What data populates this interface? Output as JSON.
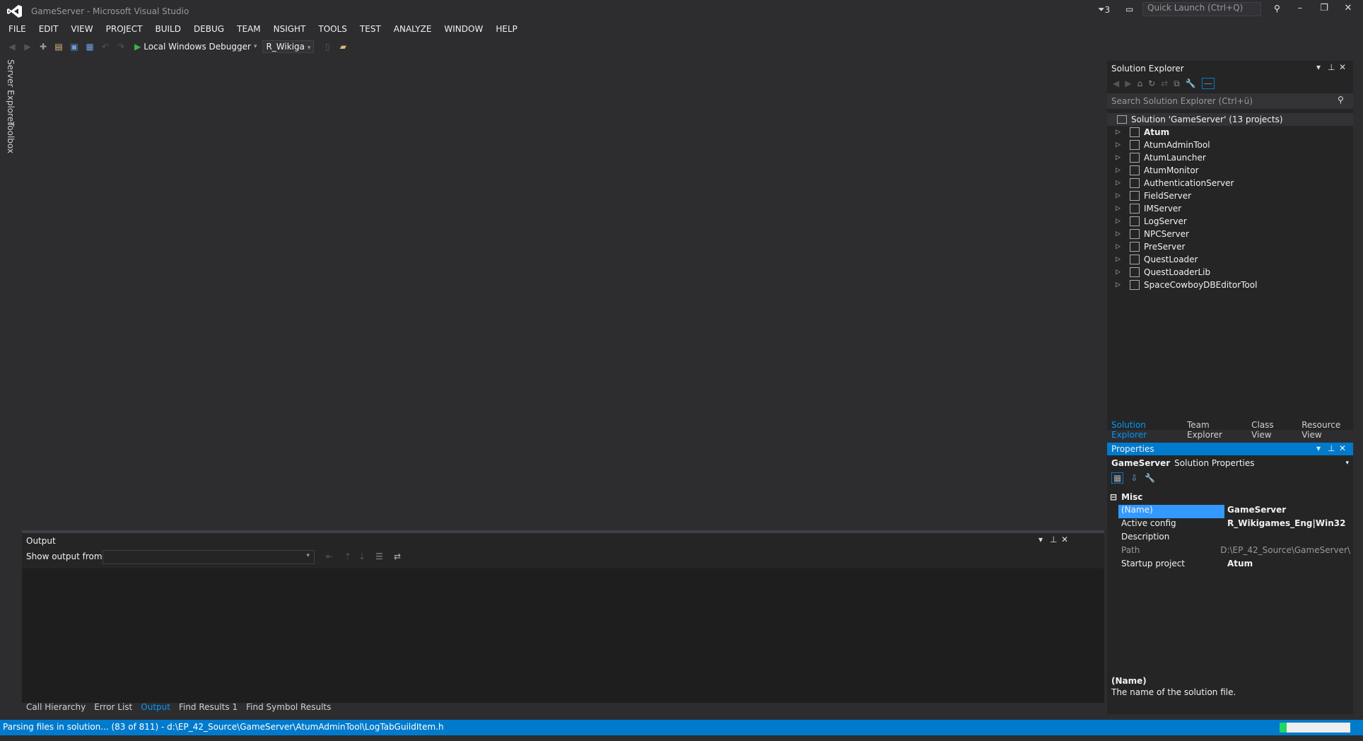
{
  "window": {
    "title": "GameServer - Microsoft Visual Studio",
    "notifications": "3"
  },
  "quick_launch": {
    "placeholder": "Quick Launch (Ctrl+Q)"
  },
  "menu": [
    "FILE",
    "EDIT",
    "VIEW",
    "PROJECT",
    "BUILD",
    "DEBUG",
    "TEAM",
    "NSIGHT",
    "TOOLS",
    "TEST",
    "ANALYZE",
    "WINDOW",
    "HELP"
  ],
  "toolbar": {
    "debugger": "Local Windows Debugger",
    "config": "R_Wikiga"
  },
  "left_tabs": [
    "Server Explorer",
    "Toolbox"
  ],
  "output": {
    "title": "Output",
    "show_from_label": "Show output from:"
  },
  "bottom_tabs": [
    "Call Hierarchy",
    "Error List",
    "Output",
    "Find Results 1",
    "Find Symbol Results"
  ],
  "bottom_active": "Output",
  "solution_explorer": {
    "title": "Solution Explorer",
    "search_placeholder": "Search Solution Explorer (Ctrl+ü)",
    "solution": "Solution 'GameServer' (13 projects)",
    "projects": [
      "Atum",
      "AtumAdminTool",
      "AtumLauncher",
      "AtumMonitor",
      "AuthenticationServer",
      "FieldServer",
      "IMServer",
      "LogServer",
      "NPCServer",
      "PreServer",
      "QuestLoader",
      "QuestLoaderLib",
      "SpaceCowboyDBEditorTool"
    ]
  },
  "explorer_tabs": [
    "Solution Explorer",
    "Team Explorer",
    "Class View",
    "Resource View"
  ],
  "properties": {
    "title": "Properties",
    "object": "GameServer",
    "object_type": "Solution Properties",
    "category": "Misc",
    "rows": [
      {
        "name": "(Name)",
        "value": "GameServer"
      },
      {
        "name": "Active config",
        "value": "R_Wikigames_Eng|Win32"
      },
      {
        "name": "Description",
        "value": ""
      },
      {
        "name": "Path",
        "value": "D:\\EP_42_Source\\GameServer\\"
      },
      {
        "name": "Startup project",
        "value": "Atum"
      }
    ],
    "desc_title": "(Name)",
    "desc_text": "The name of the solution file."
  },
  "status": {
    "text": "Parsing files in solution... (83 of 811) - d:\\EP_42_Source\\GameServer\\AtumAdminTool\\LogTabGuildItem.h",
    "progress": 0.1
  },
  "colors": {
    "accent": "#007acc",
    "background": "#2d2d30",
    "panel": "#252526"
  }
}
